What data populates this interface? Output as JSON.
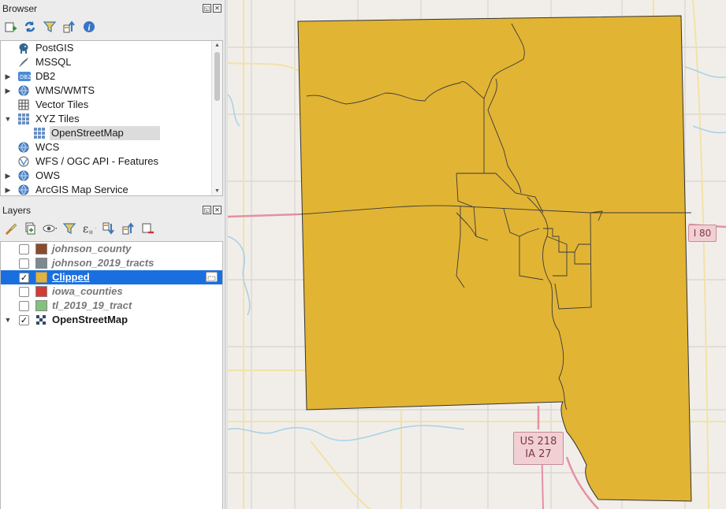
{
  "browser": {
    "title": "Browser",
    "toolbar_icons": [
      "add-layer-icon",
      "refresh-icon",
      "filter-icon",
      "collapse-all-icon",
      "info-icon"
    ],
    "items": [
      {
        "label": "PostGIS",
        "icon": "elephant-icon",
        "expandable": false,
        "indent": 0
      },
      {
        "label": "MSSQL",
        "icon": "mssql-icon",
        "expandable": false,
        "indent": 0
      },
      {
        "label": "DB2",
        "icon": "db2-icon",
        "expandable": true,
        "indent": 0
      },
      {
        "label": "WMS/WMTS",
        "icon": "globe-icon",
        "expandable": true,
        "indent": 0
      },
      {
        "label": "Vector Tiles",
        "icon": "grid-icon",
        "expandable": false,
        "indent": 0
      },
      {
        "label": "XYZ Tiles",
        "icon": "tiles-icon",
        "expandable": true,
        "expanded": true,
        "indent": 0
      },
      {
        "label": "OpenStreetMap",
        "icon": "tiles-icon",
        "expandable": false,
        "indent": 1,
        "selected": true
      },
      {
        "label": "WCS",
        "icon": "globe-icon",
        "expandable": false,
        "indent": 0
      },
      {
        "label": "WFS / OGC API - Features",
        "icon": "wfs-icon",
        "expandable": false,
        "indent": 0
      },
      {
        "label": "OWS",
        "icon": "globe-icon",
        "expandable": true,
        "indent": 0
      },
      {
        "label": "ArcGIS Map Service",
        "icon": "globe-icon",
        "expandable": true,
        "indent": 0
      }
    ]
  },
  "layers": {
    "title": "Layers",
    "toolbar_icons": [
      "style-brush-icon",
      "add-group-icon",
      "eye-icon",
      "filter-icon",
      "expression-icon",
      "expand-all-icon",
      "collapse-all-icon",
      "remove-layer-icon"
    ],
    "items": [
      {
        "label": "johnson_county",
        "checked": false,
        "color": "#8b4a2b",
        "style": "italic"
      },
      {
        "label": "johnson_2019_tracts",
        "checked": false,
        "color": "#7c8a8f",
        "style": "italic"
      },
      {
        "label": "Clipped",
        "checked": true,
        "color": "#e1b43d",
        "style": "selected"
      },
      {
        "label": "iowa_counties",
        "checked": false,
        "color": "#d43b36",
        "style": "italic"
      },
      {
        "label": "tl_2019_19_tract",
        "checked": false,
        "color": "#83c27b",
        "style": "italic"
      },
      {
        "label": "OpenStreetMap",
        "checked": true,
        "color": "",
        "style": "bold",
        "expandable": true
      }
    ]
  },
  "map": {
    "fill_color": "#e2b434",
    "shields": {
      "i80": "I 80",
      "us218_line1": "US 218",
      "us218_line2": "IA 27"
    }
  }
}
